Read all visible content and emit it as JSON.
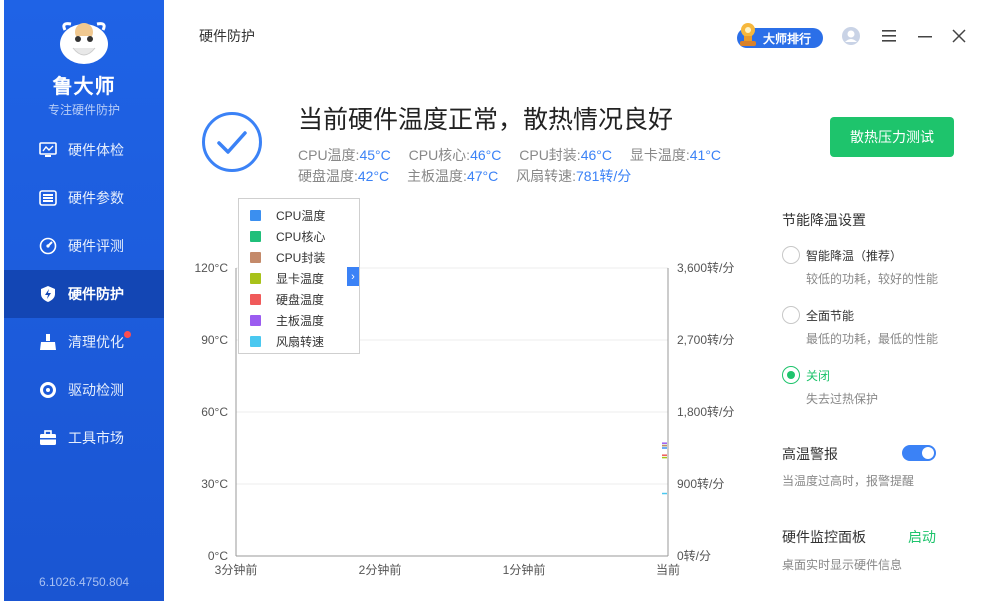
{
  "sidebar": {
    "app_name": "鲁大师",
    "app_subtitle": "专注硬件防护",
    "items": [
      {
        "label": "硬件体检",
        "icon": "monitor-icon"
      },
      {
        "label": "硬件参数",
        "icon": "list-icon"
      },
      {
        "label": "硬件评测",
        "icon": "speedometer-icon"
      },
      {
        "label": "硬件防护",
        "icon": "shield-lightning-icon",
        "active": true
      },
      {
        "label": "清理优化",
        "icon": "broom-icon",
        "badge": "red-dot"
      },
      {
        "label": "驱动检测",
        "icon": "gear-icon"
      },
      {
        "label": "工具市场",
        "icon": "toolbox-icon"
      }
    ],
    "version": "6.1026.4750.804"
  },
  "header": {
    "page_title": "硬件防护",
    "rank_label": "大师排行",
    "icons": [
      "user-icon",
      "menu-icon",
      "minimize-icon",
      "close-icon"
    ]
  },
  "status": {
    "title": "当前硬件温度正常，散热情况良好",
    "row1": [
      {
        "label": "CPU温度:",
        "value": "45°C"
      },
      {
        "label": "CPU核心:",
        "value": "46°C"
      },
      {
        "label": "CPU封装:",
        "value": "46°C"
      },
      {
        "label": "显卡温度:",
        "value": "41°C"
      }
    ],
    "row2": [
      {
        "label": "硬盘温度:",
        "value": "42°C"
      },
      {
        "label": "主板温度:",
        "value": "47°C"
      },
      {
        "label": "风扇转速:",
        "value": "781转/分"
      }
    ],
    "stress_button": "散热压力测试"
  },
  "chart_data": {
    "type": "line",
    "x_labels": [
      "3分钟前",
      "2分钟前",
      "1分钟前",
      "当前"
    ],
    "y_left_ticks": [
      "0°C",
      "30°C",
      "60°C",
      "90°C",
      "120°C"
    ],
    "y_right_ticks": [
      "0转/分",
      "900转/分",
      "1,800转/分",
      "2,700转/分",
      "3,600转/分"
    ],
    "ylim_left": [
      0,
      120
    ],
    "ylim_right": [
      0,
      3600
    ],
    "grid": true,
    "legend_position": "top-left",
    "series": [
      {
        "name": "CPU温度",
        "color": "#3b8ff0",
        "values": [
          45
        ]
      },
      {
        "name": "CPU核心",
        "color": "#1fbf7a",
        "values": [
          46
        ]
      },
      {
        "name": "CPU封装",
        "color": "#c48a6a",
        "values": [
          46
        ]
      },
      {
        "name": "显卡温度",
        "color": "#a8c21a",
        "values": [
          41
        ]
      },
      {
        "name": "硬盘温度",
        "color": "#f05a5a",
        "values": [
          42
        ]
      },
      {
        "name": "主板温度",
        "color": "#9b5cf0",
        "values": [
          47
        ]
      },
      {
        "name": "风扇转速",
        "color": "#4ac8f0",
        "values": [
          781
        ]
      }
    ]
  },
  "settings": {
    "energy_title": "节能降温设置",
    "options": [
      {
        "label": "智能降温（推荐）",
        "desc": "较低的功耗，较好的性能",
        "selected": false
      },
      {
        "label": "全面节能",
        "desc": "最低的功耗，最低的性能",
        "selected": false
      },
      {
        "label": "关闭",
        "desc": "失去过热保护",
        "selected": true
      }
    ],
    "alarm_title": "高温警报",
    "alarm_desc": "当温度过高时，报警提醒",
    "alarm_on": true,
    "monitor_title": "硬件监控面板",
    "monitor_action": "启动",
    "monitor_desc": "桌面实时显示硬件信息"
  }
}
